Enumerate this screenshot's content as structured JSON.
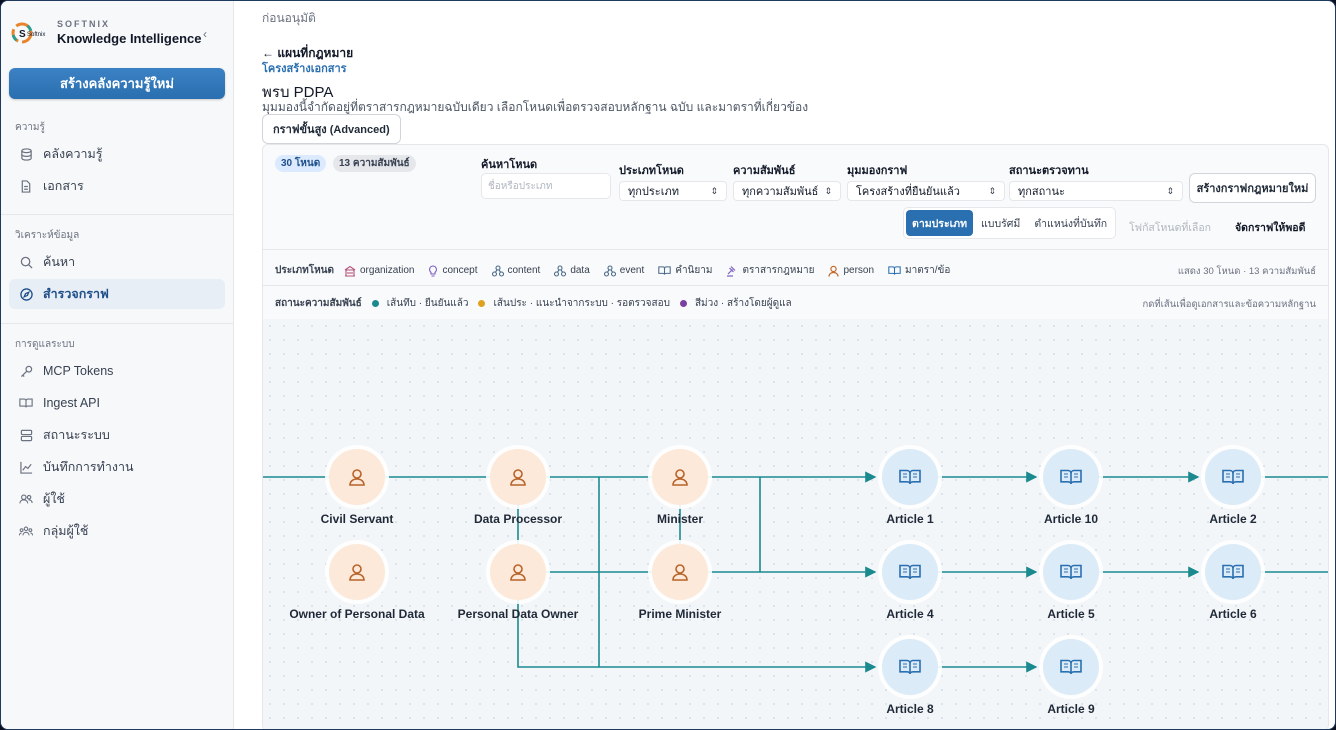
{
  "sidebar": {
    "brand_small": "SOFTNIX",
    "brand_name": "Knowledge Intelligence",
    "logo_text": "Softnix",
    "collapse_icon": "chevron-left-icon",
    "create_button": "สร้างคลังความรู้ใหม่",
    "sections": {
      "knowledge": "ความรู้",
      "analysis": "วิเคราะห์ข้อมูล",
      "admin": "การดูแลระบบ"
    },
    "items": {
      "kb": "คลังความรู้",
      "docs": "เอกสาร",
      "search": "ค้นหา",
      "explore": "สำรวจกราฟ",
      "mcp": "MCP Tokens",
      "ingest": "Ingest API",
      "status": "สถานะระบบ",
      "logs": "บันทึกการทำงาน",
      "users": "ผู้ใช้",
      "groups": "กลุ่มผู้ใช้"
    }
  },
  "header": {
    "pending": "ก่อนอนุมัติ",
    "back": "← แผนที่กฎหมาย",
    "breadcrumb": "โครงสร้างเอกสาร",
    "title": "พรบ PDPA",
    "description": "มุมมองนี้จำกัดอยู่ที่ตราสารกฎหมายฉบับเดียว เลือกโหนดเพื่อตรวจสอบหลักฐาน ฉบับ และมาตราที่เกี่ยวข้อง",
    "advanced_button": "กราฟขั้นสูง (Advanced)"
  },
  "toolbar": {
    "node_count": "30 โหนด",
    "edge_count": "13 ความสัมพันธ์",
    "search_label": "ค้นหาโหนด",
    "search_placeholder": "ชื่อหรือประเภท",
    "node_type_label": "ประเภทโหนด",
    "node_type_value": "ทุกประเภท",
    "relation_label": "ความสัมพันธ์",
    "relation_value": "ทุกความสัมพันธ์",
    "view_label": "มุมมองกราฟ",
    "view_value": "โครงสร้างที่ยืนยันแล้ว",
    "review_label": "สถานะตรวจทาน",
    "review_value": "ทุกสถานะ",
    "new_graph_button": "สร้างกราฟกฎหมายใหม่",
    "layout_modes": [
      "ตามประเภท",
      "แบบรัศมี",
      "ตำแหน่งที่บันทึก"
    ],
    "active_layout": 0,
    "focus_button": "โฟกัสโหนดที่เลือก",
    "fit_button": "จัดกราฟให้พอดี"
  },
  "legend": {
    "types_title": "ประเภทโหนด",
    "types": [
      {
        "label": "organization",
        "icon": "building-icon",
        "color": "#b5527a"
      },
      {
        "label": "concept",
        "icon": "lightbulb-icon",
        "color": "#7c5cc4"
      },
      {
        "label": "content",
        "icon": "nodes-icon",
        "color": "#4b6a88"
      },
      {
        "label": "data",
        "icon": "nodes-icon",
        "color": "#4b6a88"
      },
      {
        "label": "event",
        "icon": "nodes-icon",
        "color": "#4b6a88"
      },
      {
        "label": "คำนิยาม",
        "icon": "book-icon",
        "color": "#4b6a88"
      },
      {
        "label": "ตราสารกฎหมาย",
        "icon": "gavel-icon",
        "color": "#7c5cc4"
      },
      {
        "label": "person",
        "icon": "person-icon",
        "color": "#c2692a"
      },
      {
        "label": "มาตรา/ข้อ",
        "icon": "book-icon",
        "color": "#2a6fb0"
      }
    ],
    "summary": "แสดง 30 โหนด · 13 ความสัมพันธ์",
    "status_title": "สถานะความสัมพันธ์",
    "statuses": [
      {
        "label": "เส้นทึบ · ยืนยันแล้ว",
        "color": "#1b8a8f"
      },
      {
        "label": "เส้นประ · แนะนำจากระบบ · รอตรวจสอบ",
        "color": "#e0a020"
      },
      {
        "label": "สีม่วง · สร้างโดยผู้ดูแล",
        "color": "#7b3fa0"
      }
    ],
    "hint": "กดที่เส้นเพื่อดูเอกสารและข้อความหลักฐาน"
  },
  "graph": {
    "edge_color": "#1b8a8f",
    "nodes": [
      {
        "id": "civil",
        "label": "Civil Servant",
        "kind": "person"
      },
      {
        "id": "proc",
        "label": "Data Processor",
        "kind": "person"
      },
      {
        "id": "minister",
        "label": "Minister",
        "kind": "person"
      },
      {
        "id": "owner1",
        "label": "Owner of Personal Data",
        "kind": "person"
      },
      {
        "id": "owner2",
        "label": "Personal Data Owner",
        "kind": "person"
      },
      {
        "id": "pm",
        "label": "Prime Minister",
        "kind": "person"
      },
      {
        "id": "a1",
        "label": "Article 1",
        "kind": "article"
      },
      {
        "id": "a10",
        "label": "Article 10",
        "kind": "article"
      },
      {
        "id": "a2",
        "label": "Article 2",
        "kind": "article"
      },
      {
        "id": "a4",
        "label": "Article 4",
        "kind": "article"
      },
      {
        "id": "a5",
        "label": "Article 5",
        "kind": "article"
      },
      {
        "id": "a6",
        "label": "Article 6",
        "kind": "article"
      },
      {
        "id": "a8",
        "label": "Article 8",
        "kind": "article"
      },
      {
        "id": "a9",
        "label": "Article 9",
        "kind": "article"
      }
    ]
  }
}
